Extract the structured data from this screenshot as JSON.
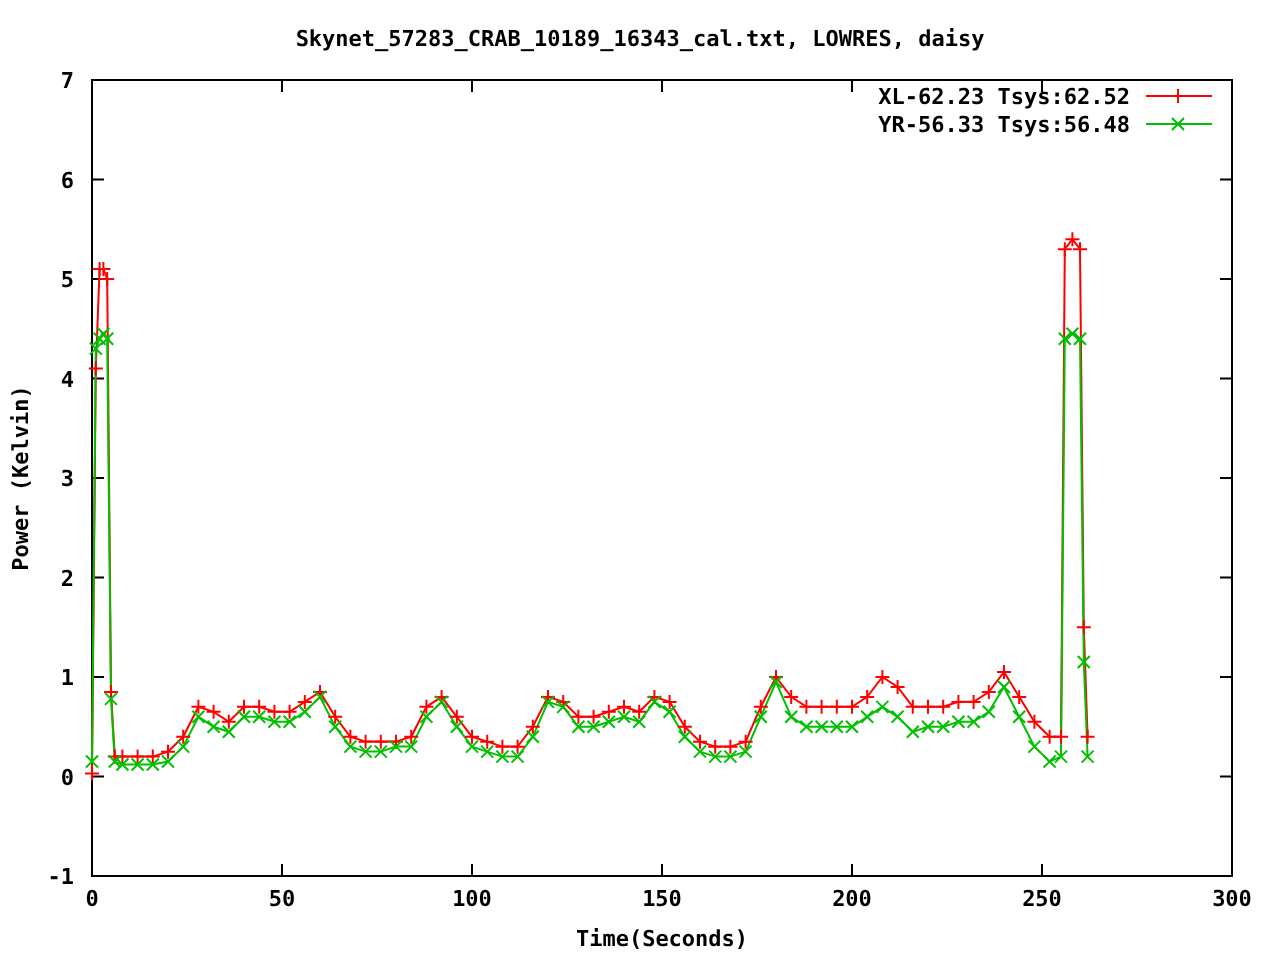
{
  "chart_data": {
    "type": "line",
    "title": "Skynet_57283_CRAB_10189_16343_cal.txt, LOWRES, daisy",
    "xlabel": "Time(Seconds)",
    "ylabel": "Power (Kelvin)",
    "x": [
      0,
      1,
      2,
      3,
      4,
      5,
      6,
      8,
      12,
      16,
      20,
      24,
      28,
      32,
      36,
      40,
      44,
      48,
      52,
      56,
      60,
      64,
      68,
      72,
      76,
      80,
      84,
      88,
      92,
      96,
      100,
      104,
      108,
      112,
      116,
      120,
      124,
      128,
      132,
      136,
      140,
      144,
      148,
      152,
      156,
      160,
      164,
      168,
      172,
      176,
      180,
      184,
      188,
      192,
      196,
      200,
      204,
      208,
      212,
      216,
      220,
      224,
      228,
      232,
      236,
      240,
      244,
      248,
      252,
      255,
      256,
      258,
      260,
      261,
      262
    ],
    "series": [
      {
        "name": "XL-62.23 Tsys:62.52",
        "color": "#ff0000",
        "marker": "plus",
        "values": [
          0.03,
          4.1,
          5.1,
          5.1,
          5.0,
          0.85,
          0.2,
          0.2,
          0.2,
          0.2,
          0.25,
          0.4,
          0.7,
          0.65,
          0.55,
          0.7,
          0.7,
          0.65,
          0.65,
          0.75,
          0.85,
          0.6,
          0.4,
          0.35,
          0.35,
          0.35,
          0.4,
          0.7,
          0.8,
          0.6,
          0.4,
          0.35,
          0.3,
          0.3,
          0.5,
          0.8,
          0.75,
          0.6,
          0.6,
          0.65,
          0.7,
          0.65,
          0.8,
          0.75,
          0.5,
          0.35,
          0.3,
          0.3,
          0.35,
          0.7,
          1.0,
          0.8,
          0.7,
          0.7,
          0.7,
          0.7,
          0.8,
          1.0,
          0.9,
          0.7,
          0.7,
          0.7,
          0.75,
          0.75,
          0.85,
          1.05,
          0.8,
          0.55,
          0.4,
          0.4,
          5.3,
          5.4,
          5.3,
          1.5,
          0.4
        ]
      },
      {
        "name": "YR-56.33 Tsys:56.48",
        "color": "#00c000",
        "marker": "cross",
        "values": [
          0.15,
          4.3,
          4.4,
          4.45,
          4.4,
          0.78,
          0.15,
          0.12,
          0.12,
          0.12,
          0.15,
          0.3,
          0.6,
          0.5,
          0.45,
          0.6,
          0.6,
          0.55,
          0.55,
          0.65,
          0.8,
          0.5,
          0.3,
          0.25,
          0.25,
          0.3,
          0.3,
          0.6,
          0.75,
          0.5,
          0.3,
          0.25,
          0.2,
          0.2,
          0.4,
          0.75,
          0.7,
          0.5,
          0.5,
          0.55,
          0.6,
          0.55,
          0.75,
          0.65,
          0.4,
          0.25,
          0.2,
          0.2,
          0.25,
          0.6,
          0.95,
          0.6,
          0.5,
          0.5,
          0.5,
          0.5,
          0.6,
          0.7,
          0.6,
          0.45,
          0.5,
          0.5,
          0.55,
          0.55,
          0.65,
          0.9,
          0.6,
          0.3,
          0.15,
          0.2,
          4.4,
          4.45,
          4.4,
          1.15,
          0.2
        ]
      }
    ],
    "legend": true,
    "xlim": [
      0,
      300
    ],
    "ylim": [
      -1,
      7
    ],
    "xticks": [
      0,
      50,
      100,
      150,
      200,
      250,
      300
    ],
    "yticks": [
      -1,
      0,
      1,
      2,
      3,
      4,
      5,
      6,
      7
    ]
  }
}
